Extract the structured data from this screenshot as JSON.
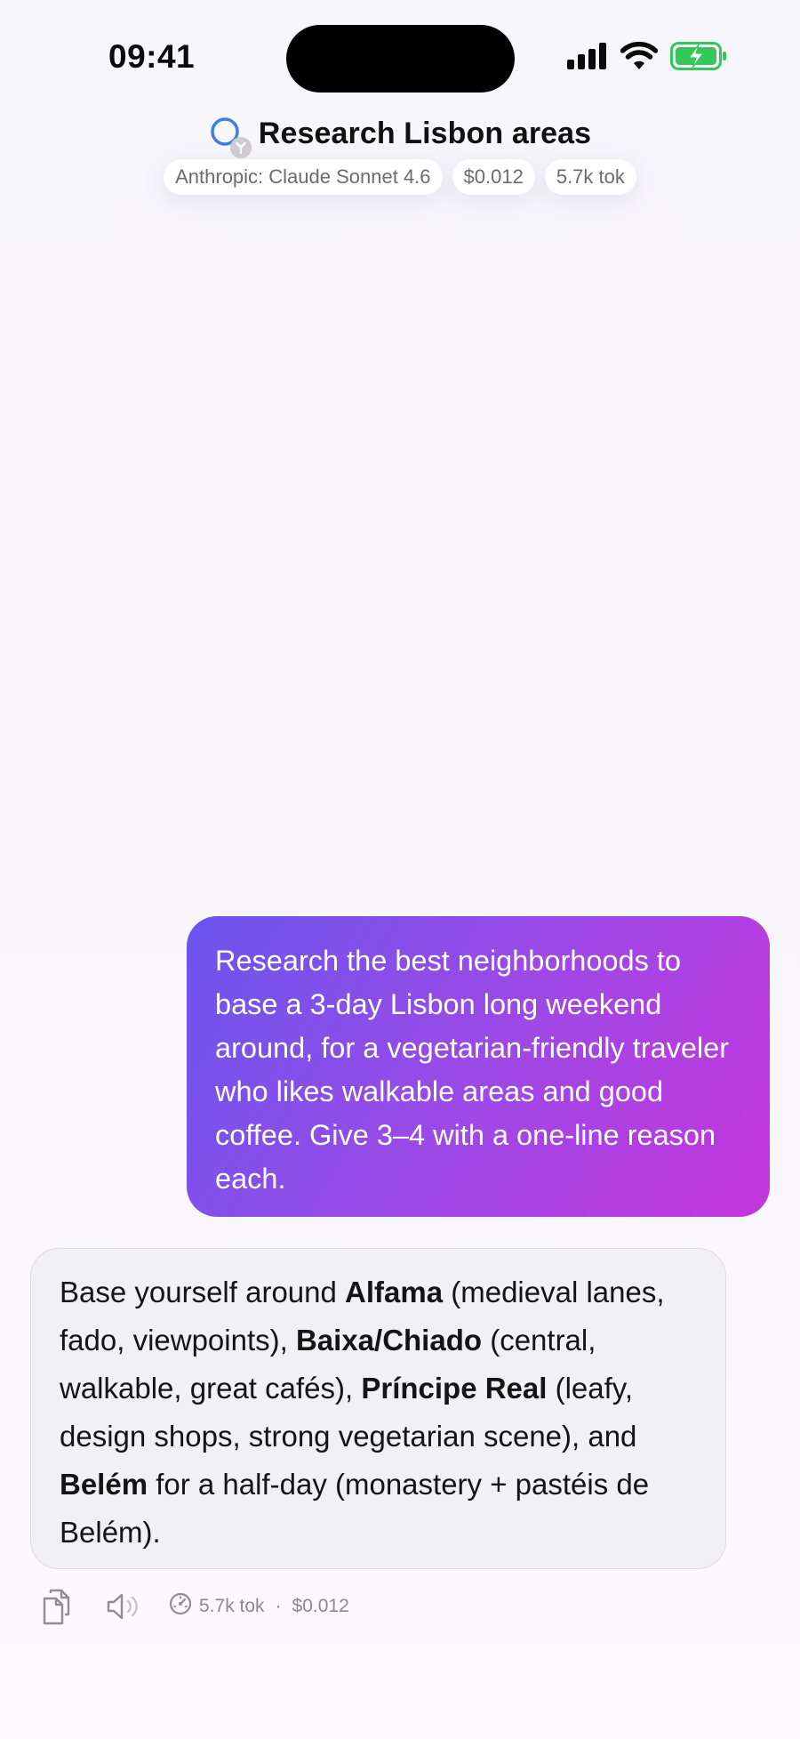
{
  "status_bar": {
    "time": "09:41",
    "icons": [
      "cellular-signal-icon",
      "wifi-icon",
      "battery-charging-icon"
    ],
    "battery_color": "#34c759"
  },
  "header": {
    "title": "Research Lisbon areas",
    "status_icon": "progress-ring-icon",
    "accent": "#3d7ee6",
    "pills": {
      "model": "Anthropic: Claude Sonnet 4.6",
      "cost": "$0.012",
      "tokens": "5.7k tok"
    }
  },
  "conversation": {
    "user_message": {
      "text": "Research the best neighborhoods to base a 3-day Lisbon long weekend around, for a vegetarian-friendly traveler who likes walkable areas and good coffee. Give 3–4 with a one-line reason each.",
      "gradient": [
        "#6a55ee",
        "#c535de"
      ]
    },
    "assistant_message": {
      "parts": [
        {
          "text": "Base yourself around "
        },
        {
          "text": "Alfama",
          "bold": true
        },
        {
          "text": " (medieval lanes, fado, viewpoints), "
        },
        {
          "text": "Baixa/Chiado",
          "bold": true
        },
        {
          "text": " (central, walkable, great cafés), "
        },
        {
          "text": "Príncipe Real",
          "bold": true
        },
        {
          "text": " (leafy, design shops, strong vegetarian scene), and "
        },
        {
          "text": "Belém",
          "bold": true
        },
        {
          "text": " for a half-day (monastery + pastéis de Belém)."
        }
      ],
      "footer": {
        "actions": [
          "copy-icon",
          "speaker-icon"
        ],
        "meta_icon": "gauge-icon",
        "tokens": "5.7k tok",
        "separator": "·",
        "cost": "$0.012"
      }
    }
  }
}
